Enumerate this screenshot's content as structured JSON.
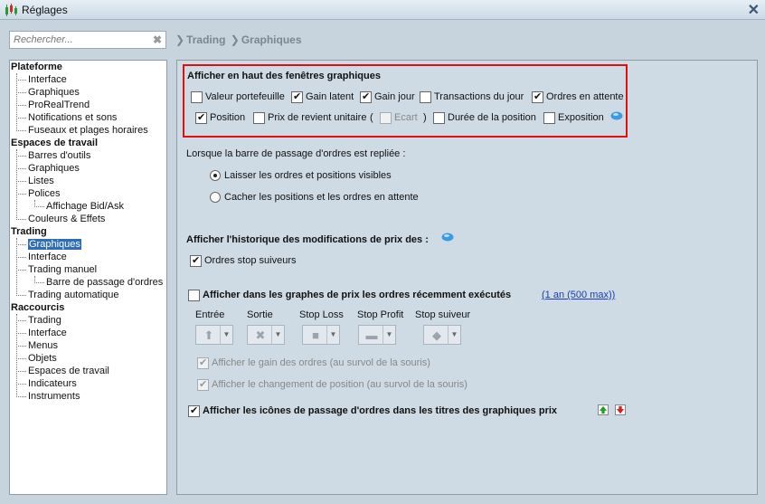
{
  "window": {
    "title": "Réglages"
  },
  "search": {
    "placeholder": "Rechercher..."
  },
  "breadcrumb": [
    "Trading",
    "Graphiques"
  ],
  "tree": [
    {
      "label": "Plateforme",
      "level": 0
    },
    {
      "label": "Interface",
      "level": 1
    },
    {
      "label": "Graphiques",
      "level": 1
    },
    {
      "label": "ProRealTrend",
      "level": 1
    },
    {
      "label": "Notifications et sons",
      "level": 1
    },
    {
      "label": "Fuseaux et plages horaires",
      "level": 1
    },
    {
      "label": "Espaces de travail",
      "level": 0
    },
    {
      "label": "Barres d'outils",
      "level": 1
    },
    {
      "label": "Graphiques",
      "level": 1
    },
    {
      "label": "Listes",
      "level": 1
    },
    {
      "label": "Polices",
      "level": 1
    },
    {
      "label": "Affichage Bid/Ask",
      "level": 2
    },
    {
      "label": "Couleurs & Effets",
      "level": 1
    },
    {
      "label": "Trading",
      "level": 0
    },
    {
      "label": "Graphiques",
      "level": 1,
      "selected": true
    },
    {
      "label": "Interface",
      "level": 1
    },
    {
      "label": "Trading manuel",
      "level": 1
    },
    {
      "label": "Barre de passage d'ordres",
      "level": 2
    },
    {
      "label": "Trading automatique",
      "level": 1
    },
    {
      "label": "Raccourcis",
      "level": 0
    },
    {
      "label": "Trading",
      "level": 1
    },
    {
      "label": "Interface",
      "level": 1
    },
    {
      "label": "Menus",
      "level": 1
    },
    {
      "label": "Objets",
      "level": 1
    },
    {
      "label": "Espaces de travail",
      "level": 1
    },
    {
      "label": "Indicateurs",
      "level": 1
    },
    {
      "label": "Instruments",
      "level": 1
    }
  ],
  "top_section": {
    "heading": "Afficher en haut des fenêtres graphiques",
    "row1": [
      {
        "label": "Valeur portefeuille",
        "checked": false
      },
      {
        "label": "Gain latent",
        "checked": true
      },
      {
        "label": "Gain jour",
        "checked": true
      },
      {
        "label": "Transactions du jour",
        "checked": false
      },
      {
        "label": "Ordres en attente",
        "checked": true
      }
    ],
    "row2": [
      {
        "label": "Position",
        "checked": true
      },
      {
        "label": "Prix de revient unitaire",
        "checked": false
      },
      {
        "label": "Ecart",
        "checked": false,
        "disabled": true
      },
      {
        "label": "Durée de la position",
        "checked": false
      },
      {
        "label": "Exposition",
        "checked": false
      }
    ],
    "paren_open": "(",
    "paren_close": ")"
  },
  "collapsed_section": {
    "label": "Lorsque la barre de passage d'ordres est repliée :",
    "options": [
      {
        "label": "Laisser les ordres et positions visibles",
        "selected": true
      },
      {
        "label": "Cacher les positions et les ordres en attente",
        "selected": false
      }
    ]
  },
  "history_section": {
    "heading": "Afficher l'historique des modifications de prix des :",
    "option": {
      "label": "Ordres stop suiveurs",
      "checked": true
    }
  },
  "executed_section": {
    "label": "Afficher dans les graphes de prix les ordres récemment exécutés",
    "checked": false,
    "link": "(1 an (500 max))",
    "columns": [
      "Entrée",
      "Sortie",
      "Stop Loss",
      "Stop Profit",
      "Stop suiveur"
    ],
    "column_icons": [
      "arrow-up-icon",
      "cross-icon",
      "square-icon",
      "dash-icon",
      "diamond-icon"
    ],
    "sub_options": [
      {
        "label": "Afficher le gain des ordres (au survol de la souris)",
        "checked": true
      },
      {
        "label": "Afficher le changement de position (au survol de la souris)",
        "checked": true
      }
    ]
  },
  "icons_section": {
    "label": "Afficher les icônes de passage d'ordres dans les titres des graphiques prix",
    "checked": true
  }
}
